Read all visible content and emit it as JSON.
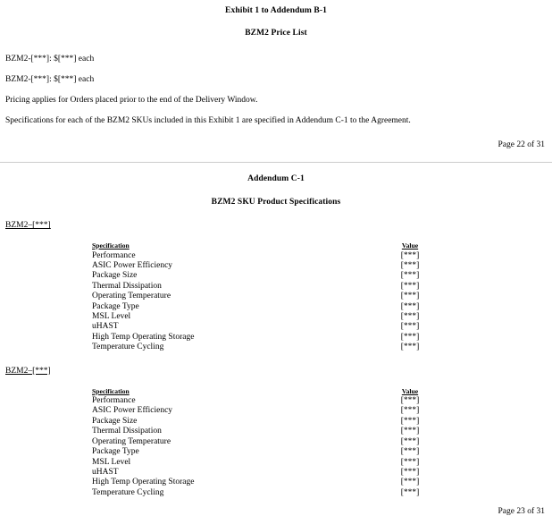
{
  "document": {
    "pages": [
      {
        "id": "page-22",
        "headings": [
          "Exhibit 1 to Addendum B-1",
          "BZM2 Price List"
        ],
        "paragraphs": [
          "BZM2-[***]: $[***] each",
          "BZM2-[***]: $[***] each",
          "Pricing applies for Orders placed prior to the end of the Delivery Window.",
          "Specifications for each of the BZM2 SKUs included in this Exhibit 1 are specified in Addendum C-1 to the Agreement."
        ],
        "footer": "Page 22 of 31"
      },
      {
        "id": "page-23",
        "headings": [
          "Addendum C-1",
          "BZM2 SKU Product Specifications"
        ],
        "sections": [
          {
            "sku_label": "BZM2–[***]",
            "table": {
              "columns": [
                "Specification",
                "Value"
              ],
              "rows": [
                [
                  "Performance",
                  "[***]"
                ],
                [
                  "ASIC Power Efficiency",
                  "[***]"
                ],
                [
                  "Package Size",
                  "[***]"
                ],
                [
                  "Thermal Dissipation",
                  "[***]"
                ],
                [
                  "Operating Temperature",
                  "[***]"
                ],
                [
                  "Package Type",
                  "[***]"
                ],
                [
                  "MSL Level",
                  "[***]"
                ],
                [
                  "uHAST",
                  "[***]"
                ],
                [
                  "High Temp Operating Storage",
                  "[***]"
                ],
                [
                  "Temperature Cycling",
                  "[***]"
                ]
              ]
            }
          },
          {
            "sku_label": "BZM2–[***]",
            "table": {
              "columns": [
                "Specification",
                "Value"
              ],
              "rows": [
                [
                  "Performance",
                  "[***]"
                ],
                [
                  "ASIC Power Efficiency",
                  "[***]"
                ],
                [
                  "Package Size",
                  "[***]"
                ],
                [
                  "Thermal Dissipation",
                  "[***]"
                ],
                [
                  "Operating Temperature",
                  "[***]"
                ],
                [
                  "Package Type",
                  "[***]"
                ],
                [
                  "MSL Level",
                  "[***]"
                ],
                [
                  "uHAST",
                  "[***]"
                ],
                [
                  "High Temp Operating Storage",
                  "[***]"
                ],
                [
                  "Temperature Cycling",
                  "[***]"
                ]
              ]
            }
          }
        ],
        "footer": "Page 23 of 31"
      }
    ]
  }
}
